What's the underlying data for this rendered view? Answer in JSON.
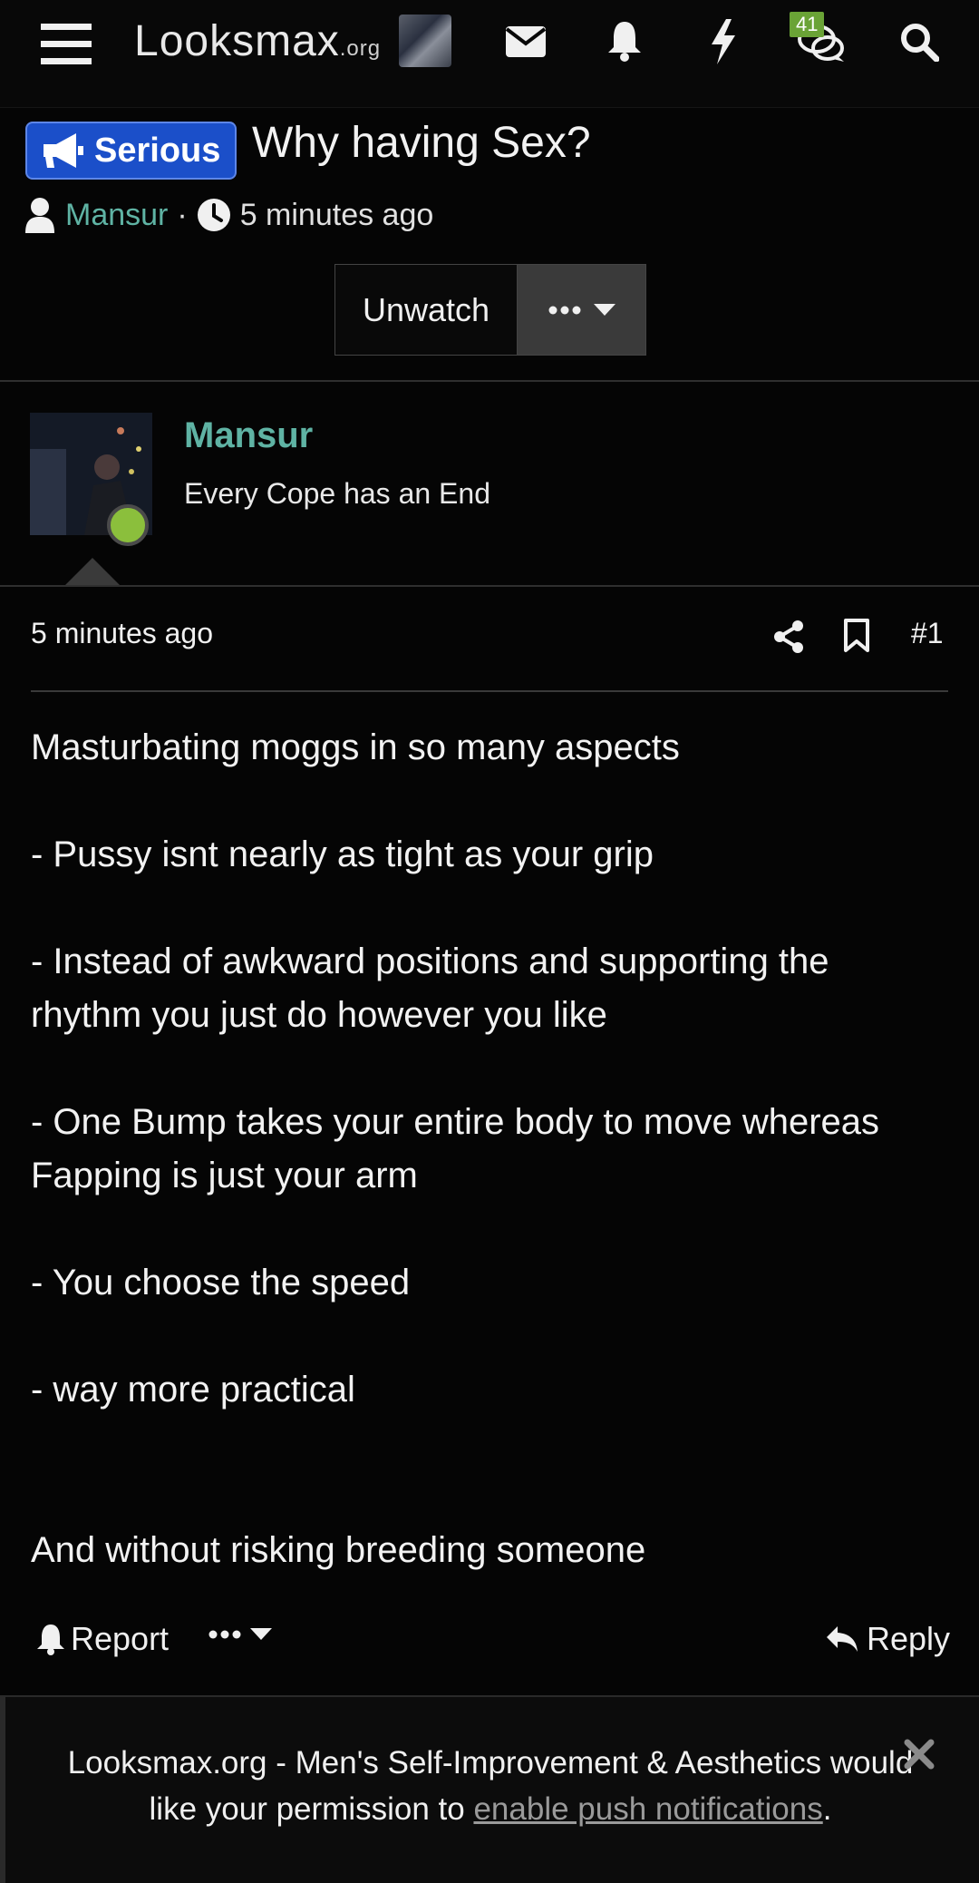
{
  "nav": {
    "logo_main": "Looksmax",
    "logo_suffix": ".org",
    "badge_count": "41"
  },
  "thread": {
    "prefix": "Serious",
    "title": "Why having Sex?",
    "author": "Mansur",
    "separator": "·",
    "time": "5 minutes ago",
    "unwatch_label": "Unwatch"
  },
  "post": {
    "username": "Mansur",
    "user_title": "Every Cope has an End",
    "time": "5 minutes ago",
    "number": "#1",
    "paragraphs": [
      "Masturbating moggs in so many aspects",
      "- Pussy isnt nearly as tight as your grip",
      "- Instead of awkward positions and supporting the rhythm you just do however you like",
      "- One Bump takes your entire body to move whereas Fapping is just your arm",
      "- You choose the speed",
      "- way more practical",
      "And without risking breeding someone"
    ],
    "report_label": "Report",
    "reply_label": "Reply"
  },
  "notice": {
    "text_before": "Looksmax.org - Men's Self-Improvement & Aesthetics would like your permission to ",
    "link_text": "enable push notifications",
    "text_after": "."
  },
  "colors": {
    "accent_teal": "#5fb3a4",
    "prefix_blue": "#1b4fc9",
    "online_green": "#8bbf3c",
    "badge_green": "#6aa336"
  }
}
